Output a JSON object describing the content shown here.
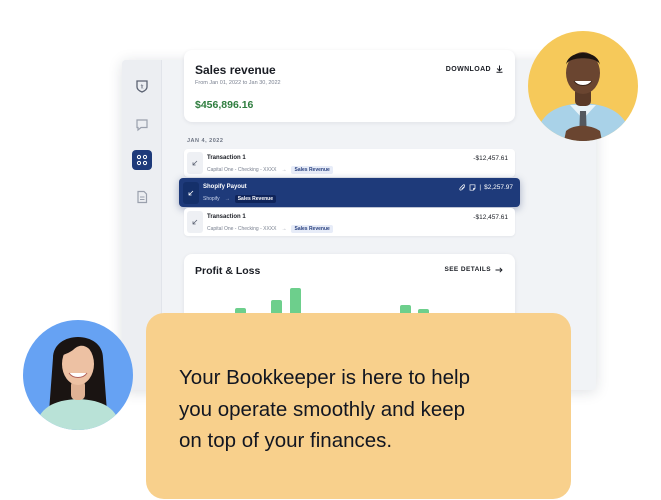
{
  "sales_card": {
    "title": "Sales revenue",
    "date_range": "From Jan 01, 2022 to Jan 30, 2022",
    "amount": "$456,896.16",
    "download_label": "DOWNLOAD"
  },
  "transactions": {
    "date_label": "JAN 4, 2022",
    "items": [
      {
        "name": "Transaction 1",
        "account": "Capital One - Checking - XXXX",
        "arrow": "→",
        "category": "Sales Revenue",
        "amount": "-$12,457.61"
      },
      {
        "name": "Shopify Payout",
        "account": "Shopify",
        "arrow": "→",
        "category": "Sales Revenue",
        "amount": "$2,257.97",
        "separator": "|"
      },
      {
        "name": "Transaction 1",
        "account": "Capital One - Checking - XXXX",
        "arrow": "→",
        "category": "Sales Revenue",
        "amount": "-$12,457.61"
      }
    ]
  },
  "profit_loss": {
    "title": "Profit & Loss",
    "see_details_label": "SEE DETAILS"
  },
  "banner": {
    "lines": [
      "Your Bookkeeper is here to help",
      "you operate smoothly and keep",
      "on top of your finances."
    ]
  },
  "sidebar": {
    "icons": [
      "shield-icon",
      "chat-icon",
      "accounts-icon",
      "document-icon"
    ]
  },
  "colors": {
    "accent": "#1e3a7a",
    "amount_green": "#2e7d3e",
    "bar_green": "#6dcf8c",
    "banner_bg": "#f8d08c",
    "avatar_yellow": "#f6c95a",
    "avatar_blue": "#66a2f3"
  }
}
